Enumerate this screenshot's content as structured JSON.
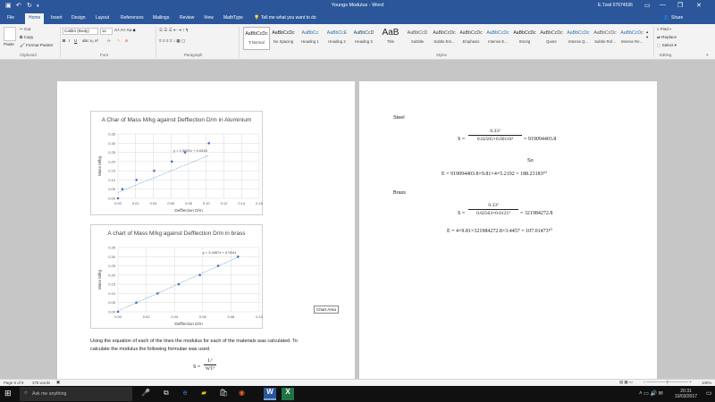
{
  "window": {
    "title": "Youngs Modulus - Word",
    "user": "E.Tzeil 07674536",
    "restore_icon": "restore-icon",
    "min_icon": "minimize-icon",
    "close_icon": "close-icon"
  },
  "tabs": [
    "File",
    "Home",
    "Insert",
    "Design",
    "Layout",
    "References",
    "Mailings",
    "Review",
    "View",
    "MathType"
  ],
  "tell_me": "Tell me what you want to do",
  "share": "Share",
  "ribbon": {
    "clipboard": {
      "paste": "Paste",
      "cut": "Cut",
      "copy": "Copy",
      "format_painter": "Format Painter",
      "label": "Clipboard"
    },
    "font": {
      "name": "Calibri (Body)",
      "size": "11",
      "label": "Font"
    },
    "paragraph": {
      "label": "Paragraph"
    },
    "styles": {
      "label": "Styles",
      "items": [
        {
          "preview": "AaBbCcDc",
          "name": "¶ Normal"
        },
        {
          "preview": "AaBbCcDc",
          "name": "No Spacing"
        },
        {
          "preview": "AaBbCc",
          "name": "Heading 1"
        },
        {
          "preview": "AaBbCcE",
          "name": "Heading 2"
        },
        {
          "preview": "AaBbCcD",
          "name": "Heading 3"
        },
        {
          "preview": "AaB",
          "name": "Title"
        },
        {
          "preview": "AaBbCcD",
          "name": "Subtitle"
        },
        {
          "preview": "AaBbCcDc",
          "name": "Subtle Em..."
        },
        {
          "preview": "AaBbCcDc",
          "name": "Emphasis"
        },
        {
          "preview": "AaBbCcDc",
          "name": "Intense E..."
        },
        {
          "preview": "AaBbCcDc",
          "name": "Strong"
        },
        {
          "preview": "AaBbCcDc",
          "name": "Quote"
        },
        {
          "preview": "AaBbCcDc",
          "name": "Intense Q..."
        },
        {
          "preview": "AaBbCcDc",
          "name": "Subtle Ref..."
        },
        {
          "preview": "AaBbCcDc",
          "name": "Intense Re..."
        }
      ]
    },
    "editing": {
      "find": "Find",
      "replace": "Replace",
      "select": "Select",
      "label": "Editing"
    }
  },
  "left_page": {
    "paragraph": "Using the equation of each of the lines the modulus for each of the materials was calculated. To calculate the modulus the following formulae was used.",
    "formula_lhs": "S =",
    "formula_num": "L³",
    "formula_den": "WT³",
    "chart_area_tip": "Chart Area"
  },
  "right_page": {
    "steel_heading": "Steel",
    "steel_S_lhs": "S =",
    "steel_S_num": "0.33³",
    "steel_S_den": "0.02505×0.00116³",
    "steel_S_res": "= 919094403.8",
    "so": "So",
    "steel_E": "E = 919094403.8×9.81×4×5.2192 = 188.23183¹⁰",
    "brass_heading": "Brass",
    "brass_S_lhs": "S =",
    "brass_S_num": "0.33³",
    "brass_S_den": "0.02563×0.0121³",
    "brass_S_res": "= 321984272.8",
    "brass_E": "E = 4×9.81×321984272.8×3.4457 = 107.01473¹⁰"
  },
  "status": {
    "page": "Page 6 of 9",
    "words": "376 words",
    "zoom": "100%"
  },
  "taskbar": {
    "search": "Ask me anything",
    "time": "20:31",
    "date": "10/03/2017"
  },
  "chart_data": [
    {
      "type": "scatter",
      "title": "A Char of Mass M/kg against Defflection D/m in Aluminium",
      "xlabel": "Defflection D/m",
      "ylabel": "Mass M/kg",
      "xlim": [
        0,
        0.16
      ],
      "ylim": [
        0,
        0.35
      ],
      "x_ticks": [
        "0.00",
        "0.02",
        "0.04",
        "0.06",
        "0.08",
        "0.10",
        "0.12",
        "0.14",
        "0.16"
      ],
      "y_ticks": [
        "0.00",
        "0.05",
        "0.10",
        "0.15",
        "0.20",
        "0.25",
        "0.30",
        "0.35"
      ],
      "trendline_label": "y = 1.9607x + 0.0318",
      "trendline": {
        "slope": 1.9607,
        "intercept": 0.0318
      },
      "grid": true,
      "series": [
        {
          "x": [
            0.0,
            0.005,
            0.021,
            0.041,
            0.061,
            0.076,
            0.103
          ],
          "y": [
            0.0,
            0.05,
            0.1,
            0.15,
            0.2,
            0.25,
            0.3
          ]
        }
      ]
    },
    {
      "type": "scatter",
      "title": "A chart of Mass M/kg against Defflection D/m in brass",
      "xlabel": "Defflection D/m",
      "ylabel": "Mass M/kg",
      "xlim": [
        0,
        0.1
      ],
      "ylim": [
        0,
        0.35
      ],
      "x_ticks": [
        "0.00",
        "0.02",
        "0.04",
        "0.06",
        "0.08",
        "0.10"
      ],
      "y_ticks": [
        "0.00",
        "0.05",
        "0.10",
        "0.15",
        "0.20",
        "0.25",
        "0.30",
        "0.35"
      ],
      "trendline_label": "y = 3.4457x + 0.0041",
      "trendline": {
        "slope": 3.4457,
        "intercept": 0.0041
      },
      "grid": true,
      "series": [
        {
          "x": [
            0.0,
            0.013,
            0.028,
            0.043,
            0.058,
            0.071,
            0.085
          ],
          "y": [
            0.0,
            0.05,
            0.1,
            0.15,
            0.2,
            0.25,
            0.3
          ]
        }
      ]
    }
  ]
}
